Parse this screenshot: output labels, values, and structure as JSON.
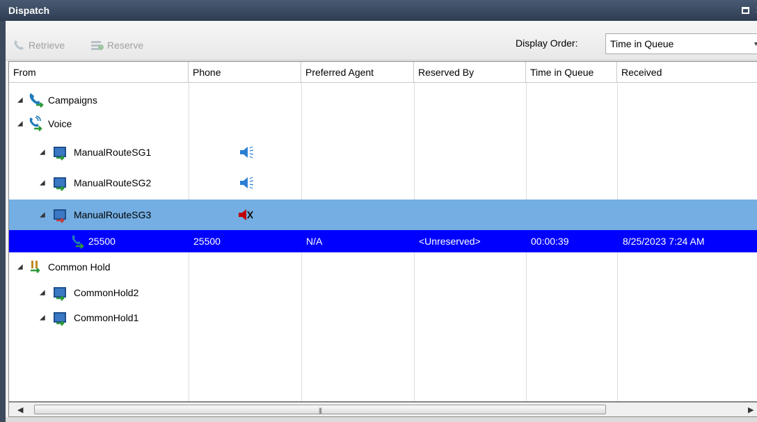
{
  "window": {
    "title": "Dispatch"
  },
  "toolbar": {
    "retrieve_label": "Retrieve",
    "reserve_label": "Reserve",
    "display_order_label": "Display Order:",
    "display_order_value": "Time in Queue"
  },
  "columns": {
    "from": "From",
    "phone": "Phone",
    "preferred_agent": "Preferred Agent",
    "reserved_by": "Reserved By",
    "time_in_queue": "Time in Queue",
    "received": "Received"
  },
  "tree": {
    "campaigns": "Campaigns",
    "voice": "Voice",
    "sg1": "ManualRouteSG1",
    "sg2": "ManualRouteSG2",
    "sg3": "ManualRouteSG3",
    "call": {
      "from": "25500",
      "phone": "25500",
      "preferred_agent": "N/A",
      "reserved_by": "<Unreserved>",
      "time_in_queue": "00:00:39",
      "received": "8/25/2023 7:24 AM"
    },
    "common_hold": "Common Hold",
    "ch2": "CommonHold2",
    "ch1": "CommonHold1"
  },
  "icons": {
    "speaker_color": "#2a7fd4",
    "muted_color": "#c00000",
    "phone_color": "#1e7ab8",
    "arrow_color": "#2e9a3a",
    "selected_row_color": "#74aee3",
    "active_row_color": "#0000ff"
  }
}
